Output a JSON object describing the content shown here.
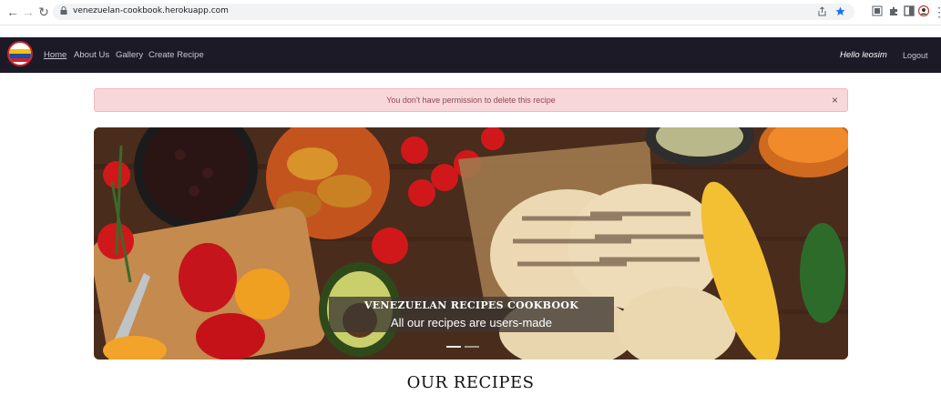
{
  "browser": {
    "url": "venezuelan-cookbook.herokuapp.com",
    "icons": [
      "back-arrow-icon",
      "forward-arrow-icon",
      "reload-icon",
      "lock-icon",
      "share-icon",
      "star-icon",
      "extension-icon",
      "puzzle-icon",
      "sidebar-icon",
      "profile-icon",
      "more-icon"
    ]
  },
  "navbar": {
    "links": [
      {
        "label": "Home"
      },
      {
        "label": "About Us"
      },
      {
        "label": "Gallery"
      },
      {
        "label": "Create Recipe"
      }
    ],
    "greeting": "Hello leosim",
    "logout_label": "Logout"
  },
  "alert": {
    "message": "You don't have permission to delete this recipe",
    "close_glyph": "×"
  },
  "hero": {
    "title": "VENEZUELAN RECIPES COOKBOOK",
    "subtitle": "All our recipes are users-made"
  },
  "section": {
    "title": "OUR RECIPES"
  },
  "colors": {
    "navbar_bg": "#1c1a26",
    "alert_bg": "#f8d7da",
    "alert_text": "#8b4a52"
  }
}
